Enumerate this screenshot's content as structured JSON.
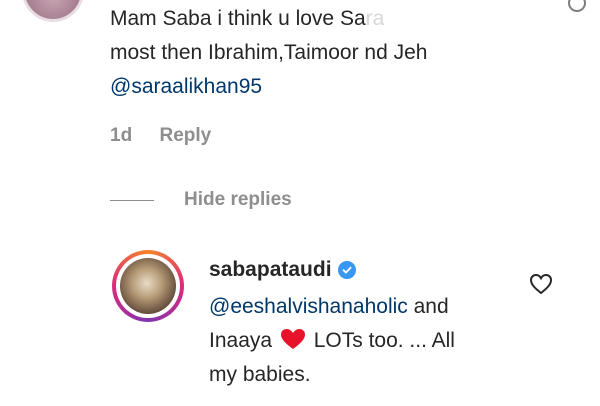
{
  "comment": {
    "line1_visible": "Mam Saba i think u love Sa",
    "line1_faded": "ra",
    "line2": "most then Ibrahim,Taimoor nd Jeh",
    "mention": "@saraalikhan95"
  },
  "meta": {
    "time": "1d",
    "reply_label": "Reply"
  },
  "hide_replies_label": "Hide replies",
  "reply": {
    "username": "sabapataudi",
    "verified": true,
    "mention": "@eeshalvishanaholic",
    "line1_rest": " and",
    "line2_before_emoji": "Inaaya ",
    "line2_after_emoji": " LOTs too. ... All",
    "line3": "my babies.",
    "emoji_icon": "red-heart-icon"
  },
  "colors": {
    "text": "#262626",
    "secondary": "#8e8e8e",
    "mention": "#00376b",
    "verified_blue": "#3897f0",
    "heart_red": "#e8132b"
  }
}
